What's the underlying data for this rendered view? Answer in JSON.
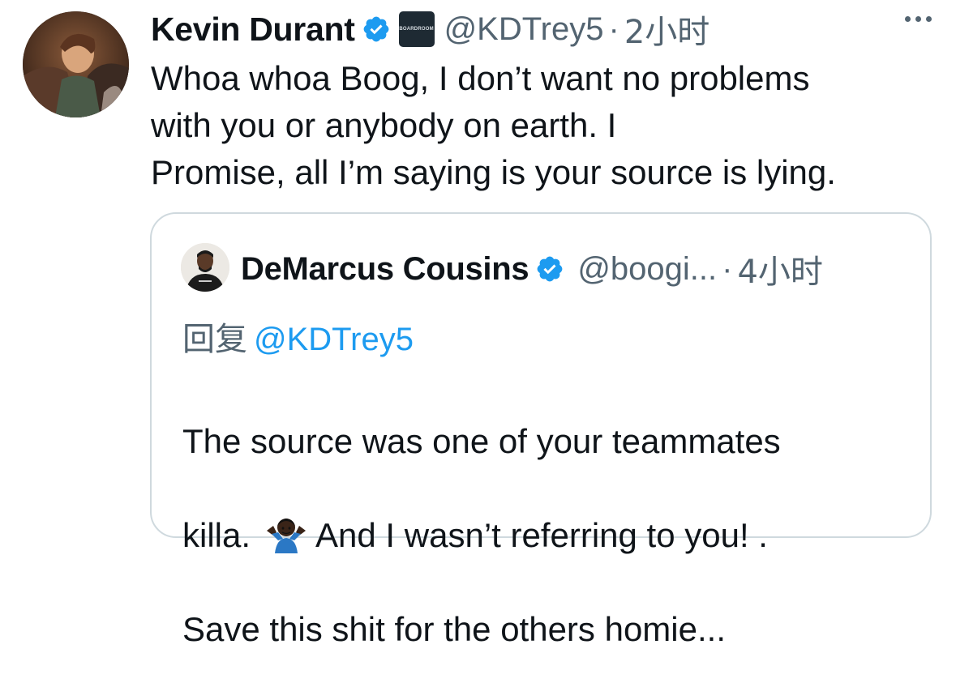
{
  "tweet": {
    "author": {
      "name": "Kevin Durant",
      "handle": "@KDTrey5",
      "affiliate_label": "BOARDROOM",
      "verified_icon": "verified-badge-icon",
      "avatar_icon": "profile-avatar"
    },
    "separator": "·",
    "time": "2小时",
    "more_icon": "more-options-icon",
    "text": "Whoa whoa Boog, I don’t want no problems\nwith you or anybody on earth. I\nPromise, all I’m saying is your source is lying."
  },
  "quoted_tweet": {
    "author": {
      "name": "DeMarcus Cousins",
      "handle": "@boogi...",
      "verified_icon": "verified-badge-icon",
      "avatar_icon": "profile-avatar"
    },
    "separator": "·",
    "time": "4小时",
    "reply_prefix": "回复",
    "reply_mention": "@KDTrey5",
    "text_line1": "The source was one of your teammates",
    "text_line2_a": "killa.",
    "emoji": "person-shrugging-emoji",
    "text_line2_b": "And I wasn’t referring to you! .",
    "text_line3": "Save this shit for the others homie..."
  },
  "colors": {
    "verified_blue": "#1d9bf0",
    "secondary_text": "#536471",
    "primary_text": "#0f1419",
    "border": "#cfd9de",
    "link": "#1d9bf0"
  }
}
